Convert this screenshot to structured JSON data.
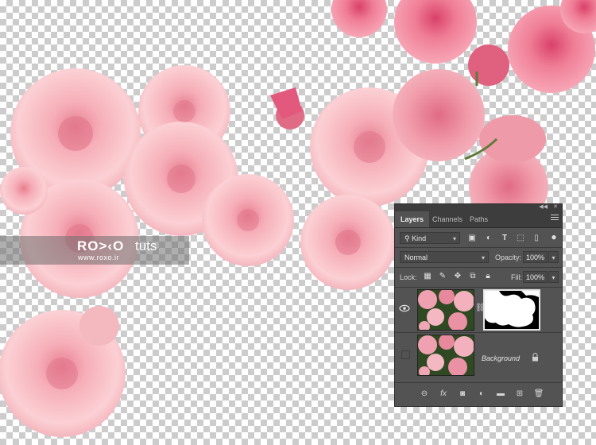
{
  "watermark": {
    "brand": "RO>‹O",
    "suffix": "tuts",
    "url": "www.roxo.ir"
  },
  "panel": {
    "tabs": [
      {
        "label": "Layers",
        "active": true
      },
      {
        "label": "Channels",
        "active": false
      },
      {
        "label": "Paths",
        "active": false
      }
    ],
    "filter": {
      "label": "Kind"
    },
    "blend_mode": "Normal",
    "opacity": {
      "label": "Opacity:",
      "value": "100%"
    },
    "lock": {
      "label": "Lock:"
    },
    "fill": {
      "label": "Fill:",
      "value": "100%"
    },
    "layers": [
      {
        "name": "",
        "visible": true,
        "has_mask": true,
        "selected": false
      },
      {
        "name": "Background",
        "visible": false,
        "locked": true
      }
    ],
    "footer_icons": [
      "link-icon",
      "fx-icon",
      "mask-icon",
      "adjustment-icon",
      "folder-icon",
      "new-layer-icon",
      "trash-icon"
    ]
  },
  "colors": {
    "panel_bg": "#535353",
    "panel_dark": "#3d3d3d",
    "rose_light": "#f6b7bf",
    "rose_mid": "#ef8a9b",
    "rose_deep": "#e25f7c"
  }
}
